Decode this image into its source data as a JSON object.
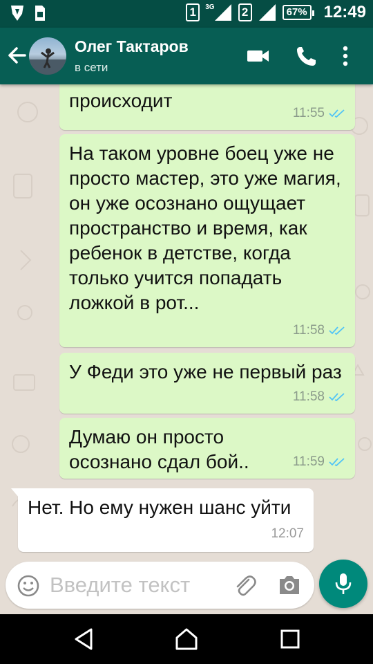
{
  "status_bar": {
    "sim1": "1",
    "sim2": "2",
    "network": "3G",
    "battery": "67%",
    "time": "12:49"
  },
  "header": {
    "contact_name": "Олег Тактаров",
    "contact_status": "в сети"
  },
  "messages": [
    {
      "text": "осознавать что с ним происходит",
      "time": "11:55",
      "direction": "out"
    },
    {
      "text": "На таком уровне боец уже не просто мастер,  это уже магия, он уже осознано ощущает пространство и время, как ребенок в детстве, когда только учится попадать ложкой в рот...",
      "time": "11:58",
      "direction": "out"
    },
    {
      "text": "У Феди это уже не первый раз",
      "time": "11:58",
      "direction": "out"
    },
    {
      "text": "Думаю он просто осознано сдал бой..",
      "time": "11:59",
      "direction": "out"
    },
    {
      "text": "Нет. Но ему нужен шанс уйти",
      "time": "12:07",
      "direction": "in"
    }
  ],
  "composer": {
    "placeholder": "Введите текст"
  },
  "icons": {
    "back": "arrow-left-icon",
    "video": "video-call-icon",
    "call": "phone-icon",
    "menu": "more-vert-icon",
    "emoji": "emoji-icon",
    "attach": "paperclip-icon",
    "camera": "camera-icon",
    "mic": "mic-icon"
  },
  "colors": {
    "header": "#075e54",
    "status_bar": "#054d44",
    "outgoing_bubble": "#dcf8c6",
    "incoming_bubble": "#ffffff",
    "read_ticks": "#4fc3f7",
    "mic_button": "#00897b",
    "chat_background": "#e5ddd5"
  }
}
